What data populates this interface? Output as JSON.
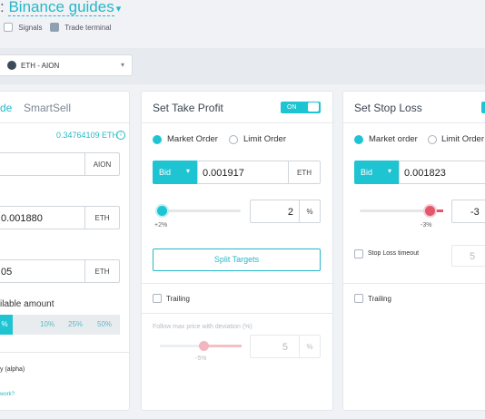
{
  "header": {
    "prefix": ":",
    "title": "Binance guides",
    "signals_label": "Signals",
    "trade_terminal_label": "Trade terminal"
  },
  "pair_selector": {
    "value": "ETH - AION"
  },
  "smart_panel": {
    "tab_partial": "de",
    "tab_smartsell": "SmartSell",
    "balance": "0.34764109 ETH",
    "amount_unit": "AION",
    "price_value": "0.001880",
    "price_unit": "ETH",
    "total_value": "05",
    "total_unit": "ETH",
    "available_label": "ilable amount",
    "percents": [
      "%",
      "10%",
      "25%",
      "50%"
    ],
    "footer_line1": "y (alpha)",
    "footer_line2": "work?"
  },
  "take_profit": {
    "title": "Set Take Profit",
    "toggle": "ON",
    "market_label": "Market Order",
    "limit_label": "Limit Order",
    "side": "Bid",
    "price": "0.001917",
    "price_unit": "ETH",
    "slider_label": "+2%",
    "slider_level": 0.05,
    "percent_value": "2",
    "percent_unit": "%",
    "split_button": "Split Targets",
    "trailing_label": "Trailing",
    "follow_label": "Follow max price with deviation (%)",
    "follow_slider_label": "-5%",
    "follow_value": "5",
    "follow_unit": "%"
  },
  "stop_loss": {
    "title": "Set Stop Loss",
    "market_label": "Market order",
    "limit_label": "Limit Order",
    "side": "Bid",
    "price": "0.001823",
    "slider_label": "-3%",
    "percent_value": "-3",
    "timeout_label": "Stop Loss timeout",
    "timeout_value": "5",
    "trailing_label": "Trailing"
  },
  "colors": {
    "accent": "#1fc4d2",
    "link": "#26b8c8",
    "danger": "#e2576a"
  }
}
